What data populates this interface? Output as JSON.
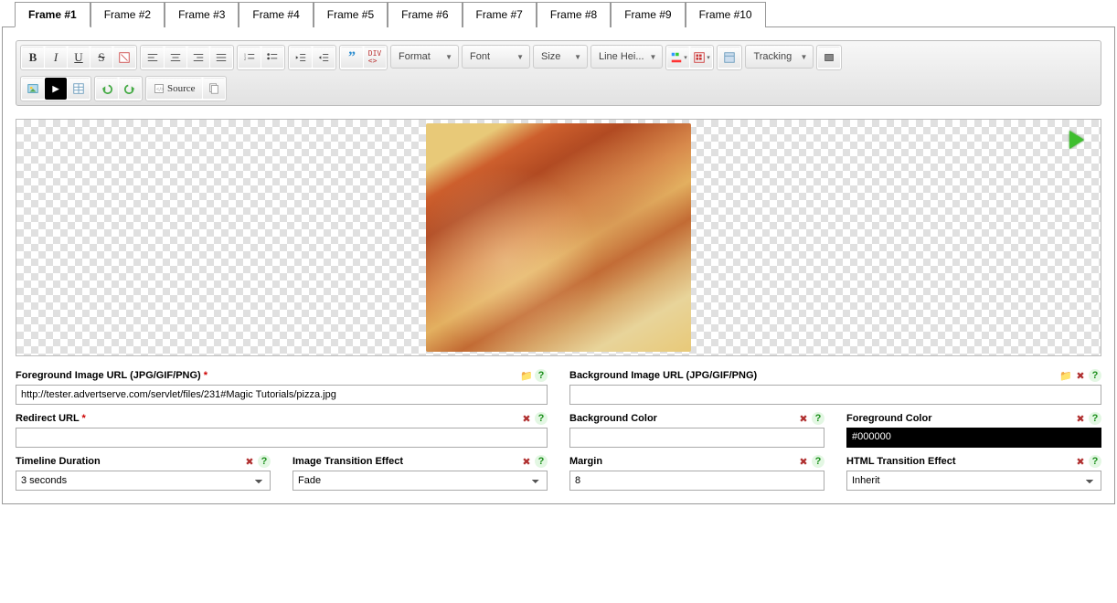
{
  "tabs": [
    {
      "label": "Frame #1",
      "active": true
    },
    {
      "label": "Frame #2"
    },
    {
      "label": "Frame #3"
    },
    {
      "label": "Frame #4"
    },
    {
      "label": "Frame #5"
    },
    {
      "label": "Frame #6"
    },
    {
      "label": "Frame #7"
    },
    {
      "label": "Frame #8"
    },
    {
      "label": "Frame #9"
    },
    {
      "label": "Frame #10"
    }
  ],
  "toolbar": {
    "format": "Format",
    "font": "Font",
    "size": "Size",
    "lineheight": "Line Hei...",
    "tracking": "Tracking",
    "source": "Source"
  },
  "fields": {
    "fg_url_label": "Foreground Image URL (JPG/GIF/PNG)",
    "fg_url_value": "http://tester.advertserve.com/servlet/files/231#Magic Tutorials/pizza.jpg",
    "bg_url_label": "Background Image URL (JPG/GIF/PNG)",
    "bg_url_value": "",
    "redirect_label": "Redirect URL",
    "redirect_value": "",
    "bgcolor_label": "Background Color",
    "bgcolor_value": "",
    "fgcolor_label": "Foreground Color",
    "fgcolor_value": "#000000",
    "duration_label": "Timeline Duration",
    "duration_value": "3 seconds",
    "imgtrans_label": "Image Transition Effect",
    "imgtrans_value": "Fade",
    "margin_label": "Margin",
    "margin_value": "8",
    "htmltrans_label": "HTML Transition Effect",
    "htmltrans_value": "Inherit"
  }
}
